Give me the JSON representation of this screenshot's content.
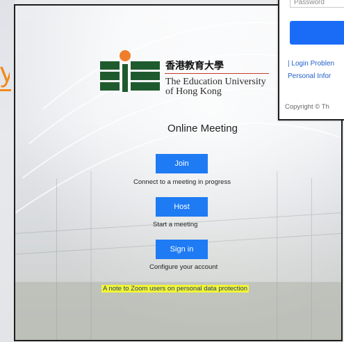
{
  "left_margin": {
    "glyph": "y"
  },
  "popup": {
    "password_placeholder": "Password",
    "login_problem": "| Login Problen",
    "personal_info": "Personal Infor",
    "copyright": "Copyright © Th"
  },
  "logo": {
    "chinese_name": "香港教育大學",
    "english_line1": "The Education University",
    "english_line2": "of Hong Kong"
  },
  "page": {
    "title": "Online Meeting"
  },
  "actions": {
    "join_label": "Join",
    "join_caption": "Connect to a meeting in progress",
    "host_label": "Host",
    "host_caption": "Start a meeting",
    "signin_label": "Sign in",
    "signin_caption": "Configure your account"
  },
  "note": {
    "text": "A note to Zoom users on personal data protection"
  },
  "colors": {
    "accent_blue": "#1e7bf4",
    "brand_green": "#1f5a2e",
    "brand_orange": "#f07d2a",
    "highlight_yellow": "#f3f531"
  }
}
